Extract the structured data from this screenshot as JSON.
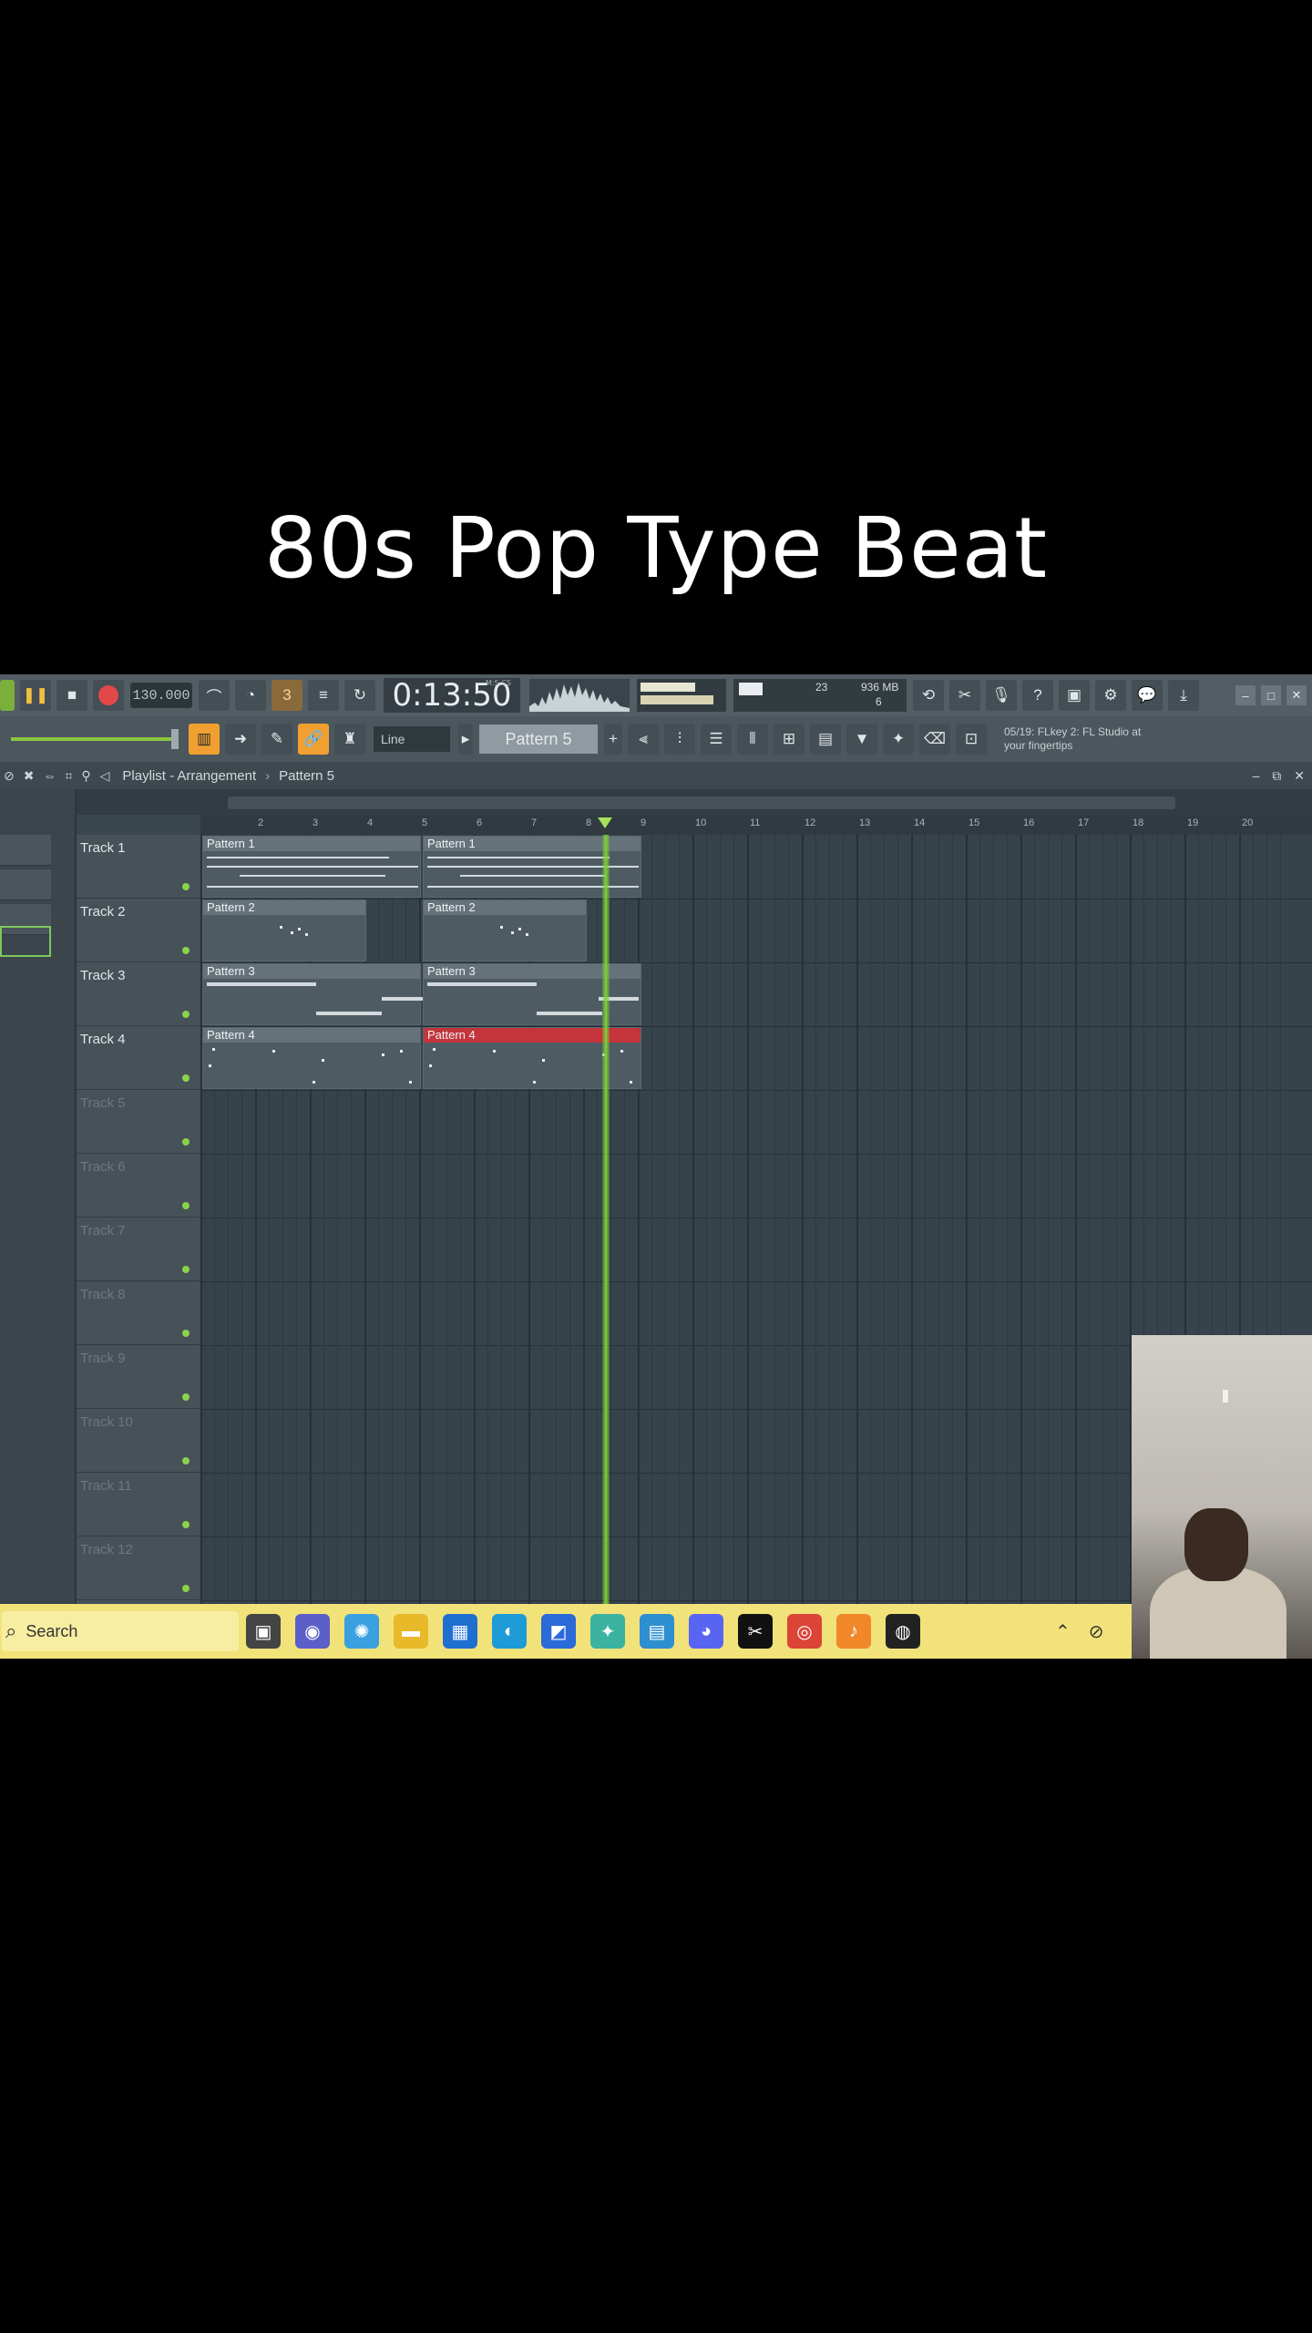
{
  "overlay": {
    "title": "80s Pop Type Beat"
  },
  "toolbar": {
    "tempo": "130.000",
    "time": "0:13:50",
    "time_unit": "M:S:CS",
    "cpu_value": "23",
    "memory": "936 MB",
    "voices": "6",
    "hint_line1": "05/19: FLkey 2: FL Studio at",
    "hint_line2": "your fingertips"
  },
  "toolbar2": {
    "snap": "Line",
    "pattern": "Pattern 5"
  },
  "playlist": {
    "title": "Playlist - Arrangement",
    "pattern": "Pattern 5",
    "bar_numbers": [
      "2",
      "3",
      "4",
      "5",
      "6",
      "7",
      "8",
      "9",
      "10",
      "11",
      "12",
      "13",
      "14",
      "15",
      "16",
      "17",
      "18",
      "19",
      "20"
    ],
    "tracks": [
      "Track 1",
      "Track 2",
      "Track 3",
      "Track 4",
      "Track 5",
      "Track 6",
      "Track 7",
      "Track 8",
      "Track 9",
      "Track 10",
      "Track 11",
      "Track 12"
    ],
    "clips": {
      "t1a": "Pattern 1",
      "t1b": "Pattern 1",
      "t2a": "Pattern 2",
      "t2b": "Pattern 2",
      "t3a": "Pattern 3",
      "t3b": "Pattern 3",
      "t4a": "Pattern 4",
      "t4b": "Pattern 4"
    }
  },
  "taskbar": {
    "search_placeholder": "Search"
  }
}
